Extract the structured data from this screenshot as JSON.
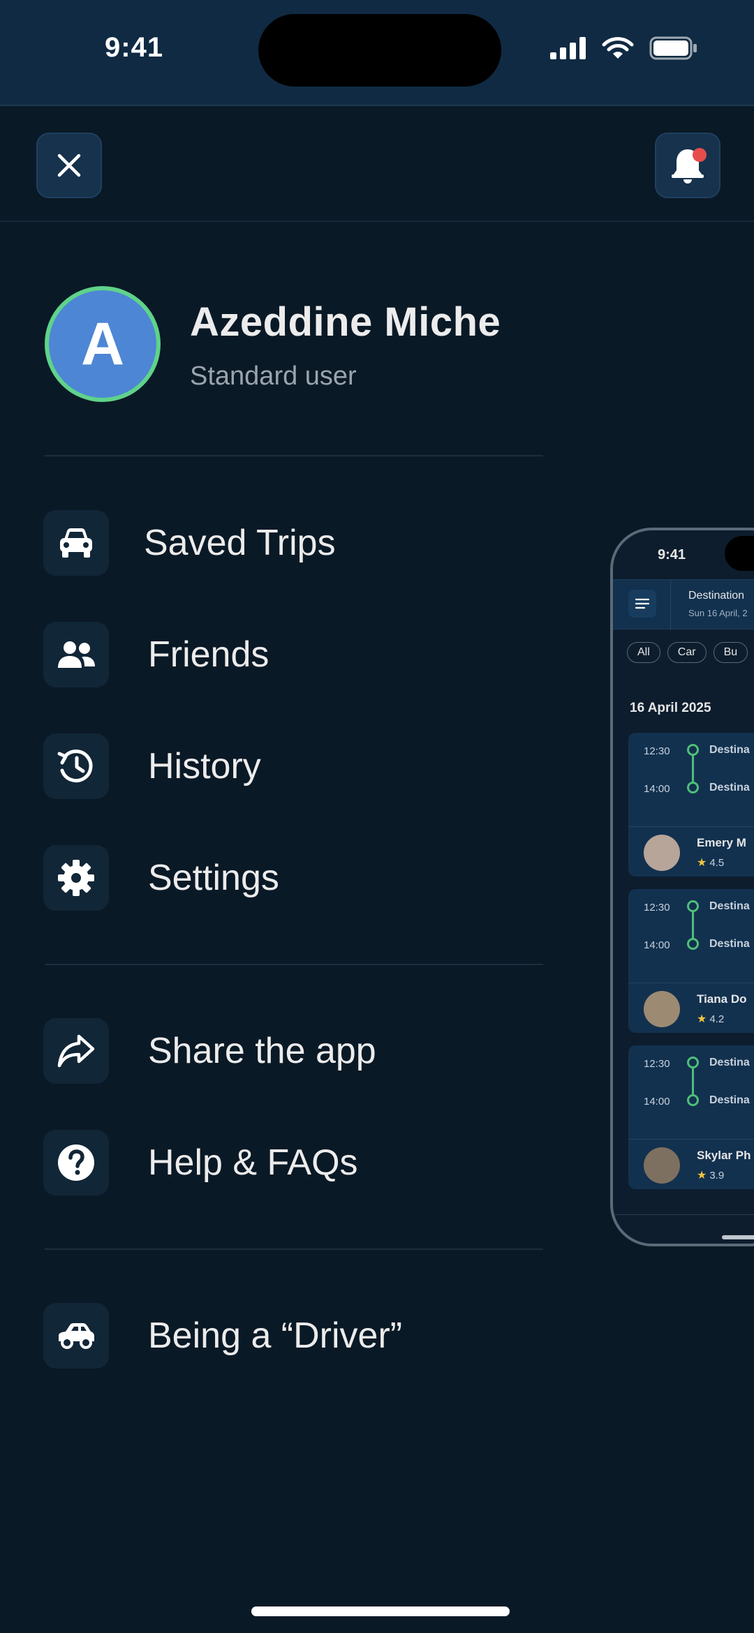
{
  "status_bar": {
    "time": "9:41"
  },
  "header": {
    "close_icon": "close-icon",
    "bell_icon": "bell-icon",
    "notification_dot_color": "#e74c4c"
  },
  "profile": {
    "avatar_letter": "A",
    "name": "Azeddine Miche",
    "role": "Standard user",
    "avatar_color": "#4d86d4",
    "ring_color": "#5fd38a"
  },
  "menu": {
    "primary": [
      {
        "label": "Saved Trips",
        "icon": "car-front-icon"
      },
      {
        "label": "Friends",
        "icon": "users-icon"
      },
      {
        "label": "History",
        "icon": "history-icon"
      },
      {
        "label": "Settings",
        "icon": "gear-icon"
      }
    ],
    "secondary": [
      {
        "label": "Share the app",
        "icon": "share-icon"
      },
      {
        "label": "Help & FAQs",
        "icon": "help-icon"
      }
    ],
    "driver": {
      "label": "Being a “Driver”",
      "icon": "car-side-icon"
    }
  },
  "preview": {
    "time": "9:41",
    "destination": "Destination",
    "date": "Sun 16 April, 2",
    "chips": [
      "All",
      "Car",
      "Bu"
    ],
    "section_date": "16 April 2025",
    "trips": [
      {
        "depart": "12:30",
        "arrive": "14:00",
        "from": "Destina",
        "to": "Destina",
        "driver": "Emery M",
        "rating": "4.5"
      },
      {
        "depart": "12:30",
        "arrive": "14:00",
        "from": "Destina",
        "to": "Destina",
        "driver": "Tiana Do",
        "rating": "4.2"
      },
      {
        "depart": "12:30",
        "arrive": "14:00",
        "from": "Destina",
        "to": "Destina",
        "driver": "Skylar Ph",
        "rating": "3.9"
      }
    ]
  }
}
